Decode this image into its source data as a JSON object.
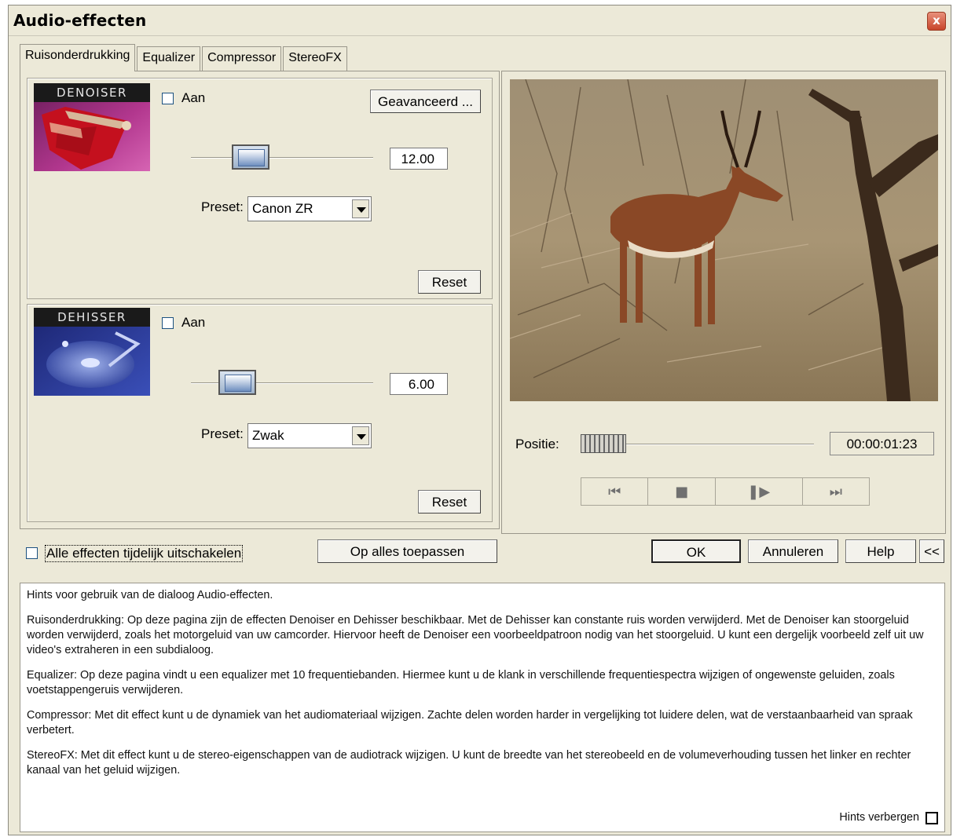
{
  "window": {
    "title": "Audio-effecten",
    "close_glyph": "x"
  },
  "tabs": [
    {
      "label": "Ruisonderdrukking",
      "active": true
    },
    {
      "label": "Equalizer",
      "active": false
    },
    {
      "label": "Compressor",
      "active": false
    },
    {
      "label": "StereoFX",
      "active": false
    }
  ],
  "denoiser": {
    "thumb_title": "DENOISER",
    "enabled_label": "Aan",
    "enabled": false,
    "advanced_label": "Geavanceerd ...",
    "slider_value": "12.00",
    "preset_label": "Preset:",
    "preset_value": "Canon ZR",
    "reset_label": "Reset"
  },
  "dehisser": {
    "thumb_title": "DEHISSER",
    "enabled_label": "Aan",
    "enabled": false,
    "slider_value": "6.00",
    "preset_label": "Preset:",
    "preset_value": "Zwak",
    "reset_label": "Reset"
  },
  "preview": {
    "position_label": "Positie:",
    "timecode": "00:00:01:23",
    "transport": {
      "rewind_icon": "skip-to-start-icon",
      "stop_icon": "stop-icon",
      "play_icon": "play-frame-icon",
      "forward_icon": "skip-to-end-icon"
    }
  },
  "footer": {
    "disable_all_label": "Alle effecten tijdelijk uitschakelen",
    "apply_all_label": "Op alles toepassen",
    "ok_label": "OK",
    "cancel_label": "Annuleren",
    "help_label": "Help",
    "collapse_label": "<<"
  },
  "hints": {
    "heading": "Hints voor gebruik van de dialoog Audio-effecten.",
    "paragraphs": [
      "Ruisonderdrukking: Op deze pagina zijn de effecten Denoiser en Dehisser beschikbaar. Met de Dehisser kan constante ruis worden verwijderd. Met de Denoiser kan stoorgeluid worden verwijderd, zoals het motorgeluid van uw camcorder. Hiervoor heeft de Denoiser een voorbeeldpatroon nodig van het stoorgeluid. U kunt een dergelijk voorbeeld zelf uit uw video's extraheren in een subdialoog.",
      "Equalizer: Op deze pagina vindt u een equalizer met 10 frequentiebanden. Hiermee kunt u de klank in verschillende frequentiespectra wijzigen of ongewenste geluiden, zoals voetstappengeruis verwijderen.",
      "Compressor: Met dit effect kunt u de dynamiek van het audiomateriaal wijzigen. Zachte delen worden harder in vergelijking tot luidere delen, wat de verstaanbaarheid van spraak verbetert.",
      "StereoFX: Met dit effect kunt u de stereo-eigenschappen van de audiotrack wijzigen. U kunt de breedte van het stereobeeld en de volumeverhouding tussen het linker en rechter kanaal van het geluid wijzigen."
    ],
    "hide_label": "Hints verbergen"
  }
}
